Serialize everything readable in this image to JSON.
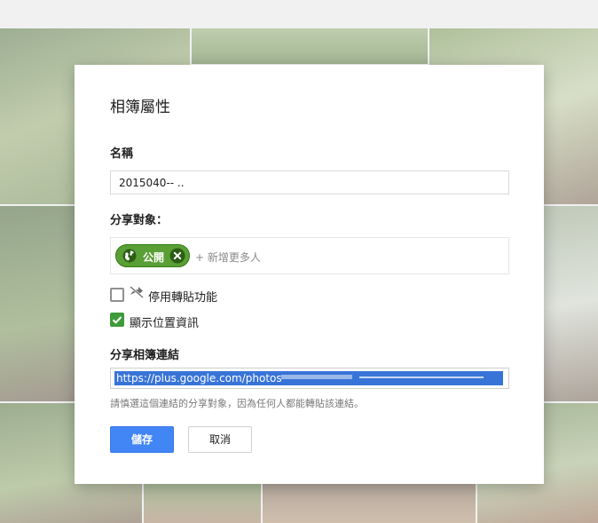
{
  "dialog": {
    "title": "相簿屬性",
    "name_label": "名稱",
    "name_value": "2015040-- ..",
    "share_label": "分享對象：",
    "share_chip": "公開",
    "add_more": "+ 新增更多人",
    "disable_reshare_label": "停用轉貼功能",
    "disable_reshare_checked": false,
    "show_location_label": "顯示位置資訊",
    "show_location_checked": true,
    "link_label": "分享相簿連結",
    "link_value": "https://plus.google.com/photos",
    "link_hint": "請慎選這個連結的分享對象，因為任何人都能轉貼該連結。",
    "save_label": "儲存",
    "cancel_label": "取消"
  },
  "colors": {
    "accent": "#4285f4",
    "chip_green": "#5a9f35",
    "checkbox_green": "#3e9b3a"
  }
}
